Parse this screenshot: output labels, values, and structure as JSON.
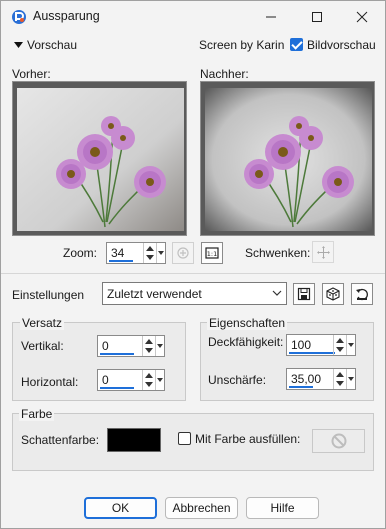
{
  "window": {
    "title": "Aussparung"
  },
  "preview_section": {
    "toggle_label": "Vorschau",
    "credit": "Screen by Karin",
    "live_preview_label": "Bildvorschau",
    "live_preview_checked": true,
    "before_label": "Vorher:",
    "after_label": "Nachher:",
    "zoom_label": "Zoom:",
    "zoom_value": "34",
    "pan_label": "Schwenken:"
  },
  "settings_bar": {
    "label": "Einstellungen",
    "preset_value": "Zuletzt verwendet"
  },
  "offset_group": {
    "title": "Versatz",
    "vertical_label": "Vertikal:",
    "vertical_value": "0",
    "horizontal_label": "Horizontal:",
    "horizontal_value": "0"
  },
  "properties_group": {
    "title": "Eigenschaften",
    "opacity_label": "Deckfähigkeit:",
    "opacity_value": "100",
    "blur_label": "Unschärfe:",
    "blur_value": "35,00"
  },
  "color_group": {
    "title": "Farbe",
    "shadow_color_label": "Schattenfarbe:",
    "shadow_color": "#000000",
    "fill_label": "Mit Farbe ausfüllen:",
    "fill_checked": false
  },
  "buttons": {
    "ok": "OK",
    "cancel": "Abbrechen",
    "help": "Hilfe"
  },
  "colors": {
    "accent": "#1e6fd9"
  }
}
